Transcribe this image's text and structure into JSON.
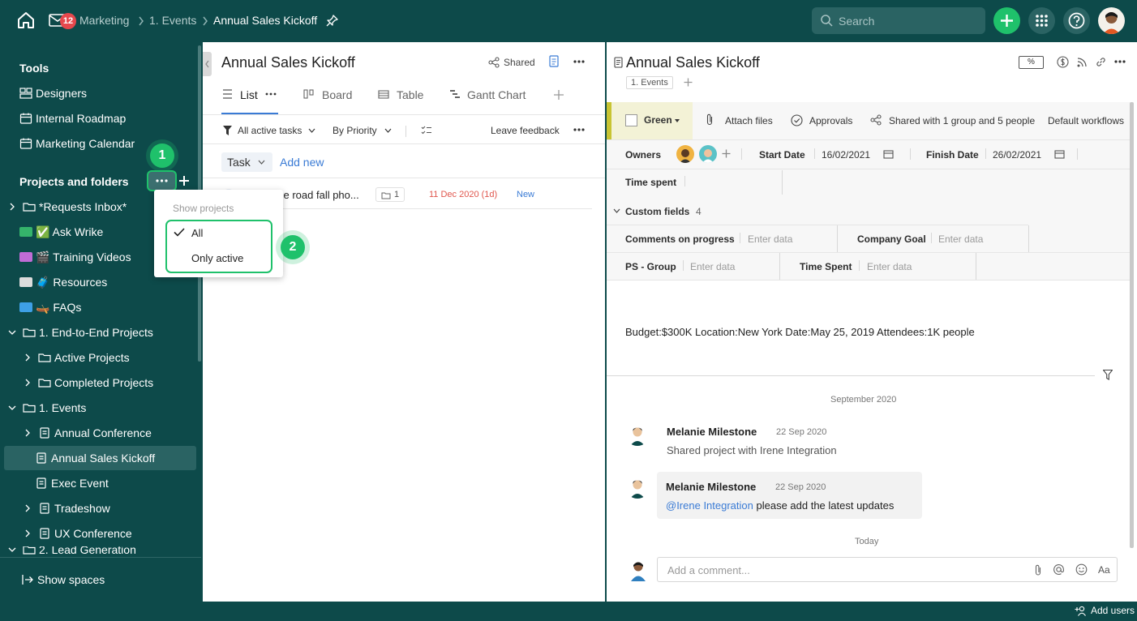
{
  "topbar": {
    "notification_count": "12",
    "breadcrumb": [
      "Marketing",
      "1. Events",
      "Annual Sales Kickoff"
    ],
    "search_placeholder": "Search"
  },
  "sidebar": {
    "tools_heading": "Tools",
    "tools": [
      "Designers",
      "Internal Roadmap",
      "Marketing Calendar"
    ],
    "projects_heading": "Projects and folders",
    "tree": [
      {
        "label": "*Requests Inbox*"
      },
      {
        "label": "✅ Ask Wrike"
      },
      {
        "label": "🎬 Training Videos"
      },
      {
        "label": "🧳 Resources"
      },
      {
        "label": "🛶 FAQs"
      },
      {
        "label": "1. End-to-End Projects"
      },
      {
        "label": "Active Projects"
      },
      {
        "label": "Completed Projects"
      },
      {
        "label": "1. Events"
      },
      {
        "label": "Annual Conference"
      },
      {
        "label": "Annual Sales Kickoff"
      },
      {
        "label": "Exec Event"
      },
      {
        "label": "Tradeshow"
      },
      {
        "label": "UX Conference"
      },
      {
        "label": "2. Lead Generation"
      }
    ],
    "show_spaces": "Show spaces"
  },
  "dropdown": {
    "heading": "Show projects",
    "options": [
      "All",
      "Only active"
    ],
    "selected": "All"
  },
  "callouts": {
    "one": "1",
    "two": "2"
  },
  "middle": {
    "title": "Annual Sales Kickoff",
    "shared_label": "Shared",
    "tabs": [
      "List",
      "Board",
      "Table",
      "Gantt Chart"
    ],
    "filter_tasks": "All active tasks",
    "sort": "By Priority",
    "leave_feedback": "Leave feedback",
    "task_button": "Task",
    "add_new": "Add new",
    "task_row": {
      "title": "se road fall pho...",
      "subtask_count": "1",
      "date": "11 Dec 2020 (1d)",
      "status": "New"
    }
  },
  "right": {
    "title": "Annual Sales Kickoff",
    "percent_label": "%",
    "folder_tag": "1. Events",
    "status": "Green",
    "attach_files": "Attach files",
    "approvals": "Approvals",
    "shared_with": "Shared with 1 group and 5 people",
    "default_workflows": "Default workflows",
    "owners_label": "Owners",
    "start_date_label": "Start Date",
    "start_date": "16/02/2021",
    "finish_date_label": "Finish Date",
    "finish_date": "26/02/2021",
    "time_spent_label": "Time spent",
    "custom_fields_label": "Custom fields",
    "custom_fields_count": "4",
    "custom_fields": [
      {
        "label": "Comments on progress",
        "placeholder": "Enter data"
      },
      {
        "label": "Company Goal",
        "placeholder": "Enter data"
      },
      {
        "label": "PS - Group",
        "placeholder": "Enter data"
      },
      {
        "label": "Time Spent",
        "placeholder": "Enter data"
      }
    ],
    "description": "Budget:$300K Location:New York Date:May 25, 2019 Attendees:1K people",
    "stream_date": "September 2020",
    "comments": [
      {
        "author": "Melanie Milestone",
        "date": "22 Sep 2020",
        "text": "Shared project with Irene Integration",
        "mention": ""
      },
      {
        "author": "Melanie Milestone",
        "date": "22 Sep 2020",
        "text": " please add the latest updates",
        "mention": "@Irene Integration"
      }
    ],
    "today_label": "Today",
    "comment_placeholder": "Add a comment...",
    "format_label": "Aa"
  },
  "footer": {
    "add_users": "Add users"
  },
  "colors": {
    "brand_dark": "#0d4a4a",
    "accent_green": "#1fc16b",
    "link_blue": "#3a7bd5",
    "date_red": "#e0564d",
    "status_bar": "#c8c432"
  }
}
